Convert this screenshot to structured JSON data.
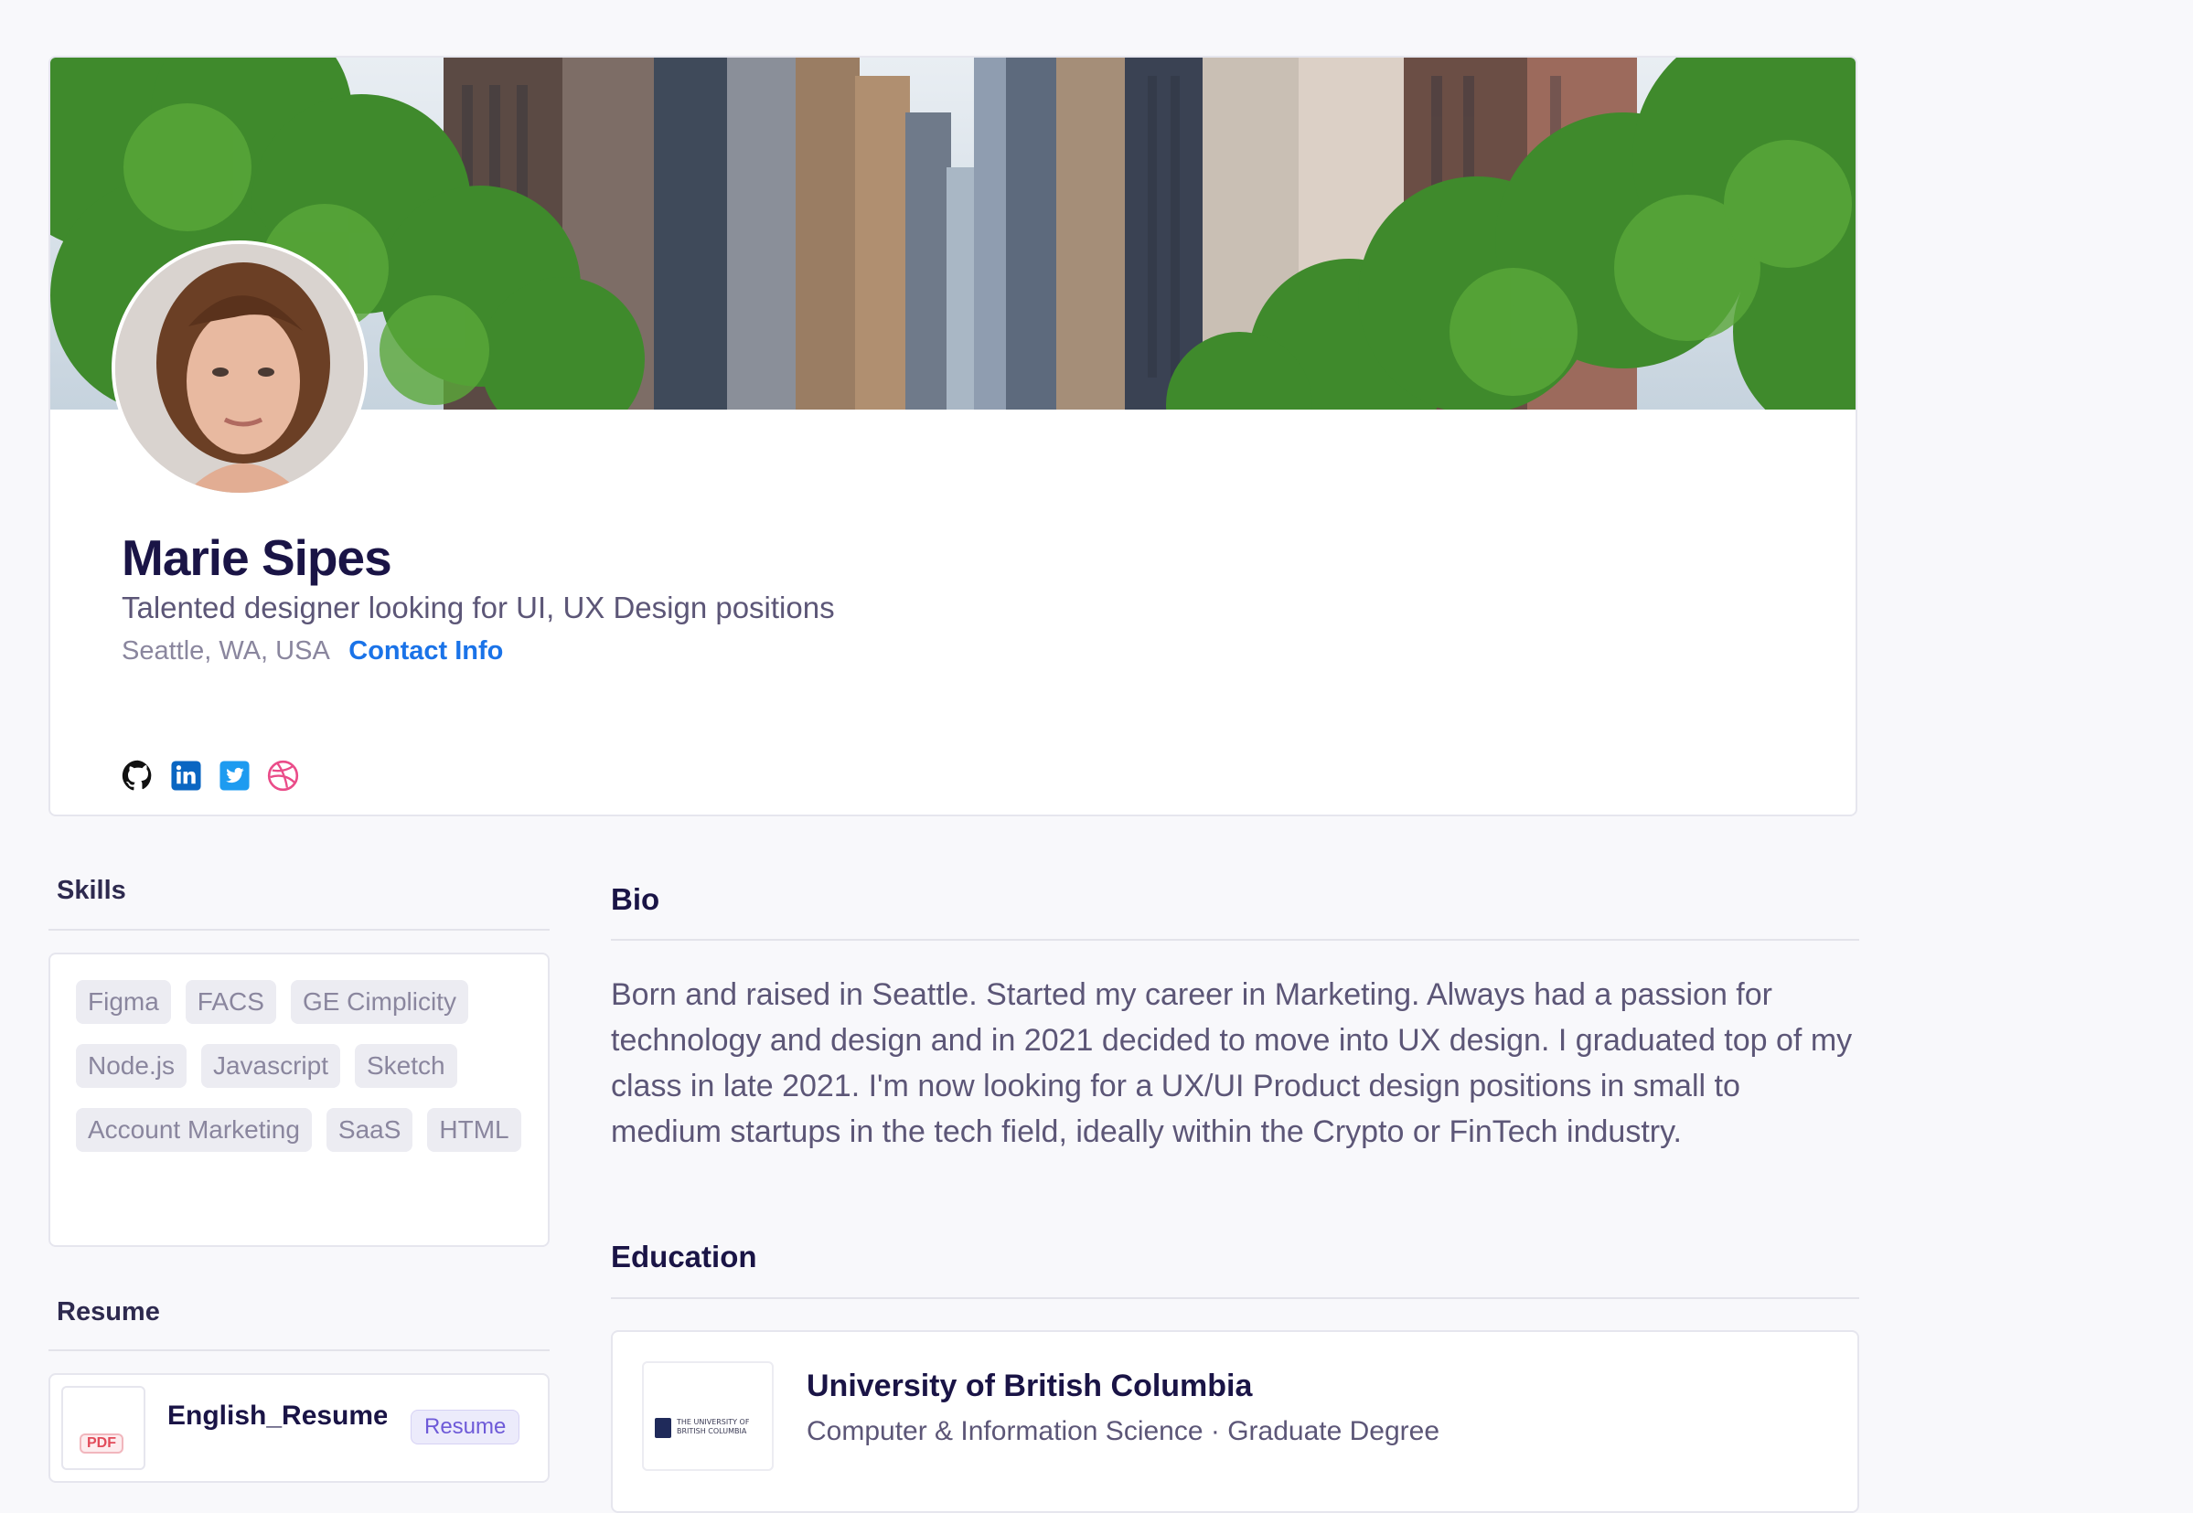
{
  "profile": {
    "name": "Marie Sipes",
    "headline": "Talented designer looking for UI, UX Design positions",
    "location": "Seattle, WA, USA",
    "contact_label": "Contact Info",
    "socials": [
      "github-icon",
      "linkedin-icon",
      "twitter-icon",
      "dribbble-icon"
    ]
  },
  "skills": {
    "title": "Skills",
    "items": [
      "Figma",
      "FACS",
      "GE Cimplicity",
      "Node.js",
      "Javascript",
      "Sketch",
      "Account Marketing",
      "SaaS",
      "HTML"
    ]
  },
  "resume": {
    "title": "Resume",
    "file_name": "English_Resume.pdf",
    "file_type": "PDF",
    "badge": "Resume"
  },
  "bio": {
    "title": "Bio",
    "text": "Born and raised in Seattle. Started my career in Marketing. Always had a passion for technology and design and in 2021 decided to move into UX design. I graduated top of my class in late 2021. I'm now looking for a UX/UI Product design positions in small to medium startups in the tech field, ideally within the Crypto or FinTech industry."
  },
  "education": {
    "title": "Education",
    "school": "University of British Columbia",
    "degree": "Computer & Information Science · Graduate Degree",
    "logo_text": "THE UNIVERSITY OF BRITISH COLUMBIA"
  },
  "colors": {
    "accent_link": "#1a73e8",
    "heading": "#1a1446",
    "body_text": "#5c5677",
    "tag_bg": "#ececf2"
  }
}
